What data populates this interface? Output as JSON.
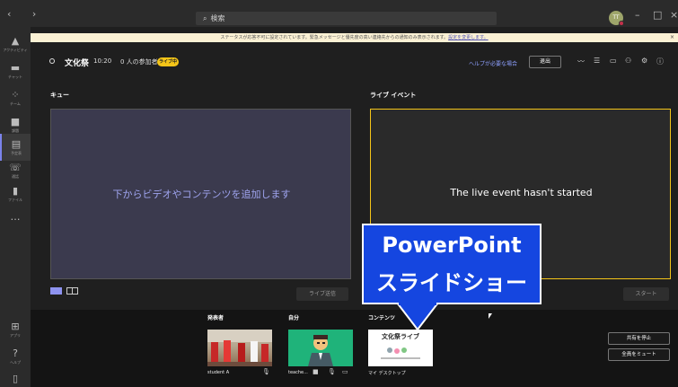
{
  "topbar": {
    "nav": "‹  ›",
    "search_placeholder": "検索",
    "avatar_initials": "TT"
  },
  "rail": {
    "items": [
      {
        "icon": "bell-icon",
        "label": "アクティビティ"
      },
      {
        "icon": "chat-icon",
        "label": "チャット"
      },
      {
        "icon": "teams-icon",
        "label": "チーム"
      },
      {
        "icon": "calendar-icon",
        "label": "課題"
      },
      {
        "icon": "meeting-icon",
        "label": "予定表"
      },
      {
        "icon": "phone-icon",
        "label": "通話"
      },
      {
        "icon": "files-icon",
        "label": "ファイル"
      }
    ],
    "more": "…",
    "apps_label": "アプリ",
    "help_label": "ヘルプ"
  },
  "notification": {
    "text": "ステータスが応答不可に設定されています。緊急メッセージと優先度の高い連絡先からの通知のみ表示されます。",
    "link": "設定を変更します。",
    "close": "×"
  },
  "meeting": {
    "title": "文化祭",
    "time": "10:20",
    "participants": "0 人の参加者",
    "live_badge": "ライブ中",
    "help_link": "ヘルプが必要な場合",
    "exit_label": "退出"
  },
  "queue": {
    "heading": "キュー",
    "placeholder": "下からビデオやコンテンツを追加します",
    "send_label": "ライブ送信"
  },
  "live": {
    "heading": "ライブ イベント",
    "status": "The live event hasn't started",
    "start_label": "スタート"
  },
  "callout": {
    "line1": "PowerPoint",
    "line2": "スライドショー"
  },
  "bottom": {
    "presenter_heading": "発表者",
    "self_heading": "自分",
    "content_heading": "コンテンツ",
    "presenter_name": "student A",
    "self_name": "teache...",
    "content_name": "マイ デスクトップ",
    "content_thumb_title": "文化祭ライブ",
    "stop_share_label": "共有を停止",
    "mute_all_label": "全員をミュート"
  },
  "colors": {
    "accent": "#7b83eb",
    "live_border": "#f5c518",
    "callout_bg": "#1546e0"
  }
}
